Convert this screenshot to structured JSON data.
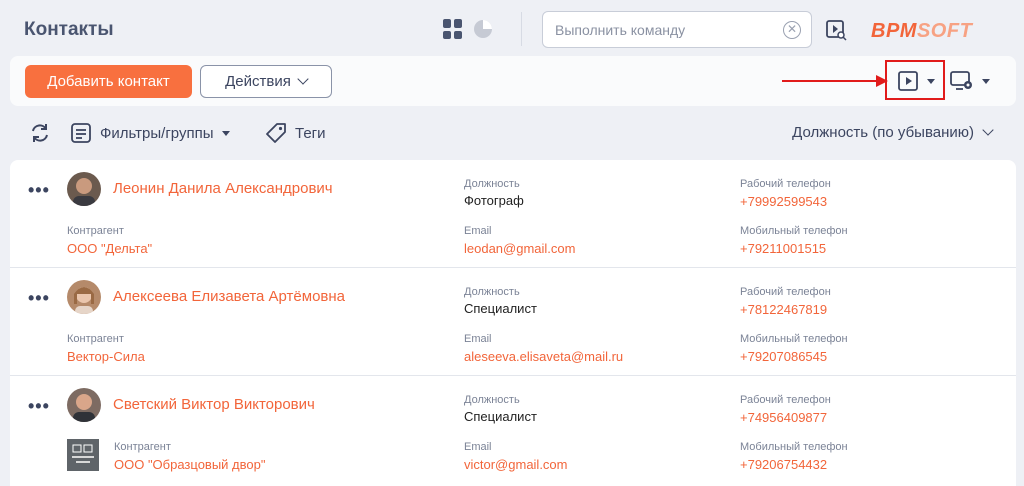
{
  "header": {
    "title": "Контакты",
    "command_placeholder": "Выполнить команду",
    "logo_a": "BPM",
    "logo_b": "SOFT"
  },
  "toolbar": {
    "add_label": "Добавить контакт",
    "actions_label": "Действия"
  },
  "filters": {
    "filters_label": "Фильтры/группы",
    "tags_label": "Теги",
    "sort_label": "Должность (по убыванию)"
  },
  "contacts": [
    {
      "name": "Леонин Данила Александрович",
      "position_label": "Должность",
      "position": "Фотограф",
      "work_phone_label": "Рабочий телефон",
      "work_phone": "+79992599543",
      "account_label": "Контрагент",
      "account": "ООО \"Дельта\"",
      "email_label": "Email",
      "email": "leodan@gmail.com",
      "mobile_label": "Мобильный телефон",
      "mobile": "+79211001515"
    },
    {
      "name": "Алексеева Елизавета Артёмовна",
      "position_label": "Должность",
      "position": "Специалист",
      "work_phone_label": "Рабочий телефон",
      "work_phone": "+78122467819",
      "account_label": "Контрагент",
      "account": "Вектор-Сила",
      "email_label": "Email",
      "email": "aleseeva.elisaveta@mail.ru",
      "mobile_label": "Мобильный телефон",
      "mobile": "+79207086545"
    },
    {
      "name": "Светский Виктор Викторович",
      "position_label": "Должность",
      "position": "Специалист",
      "work_phone_label": "Рабочий телефон",
      "work_phone": "+74956409877",
      "account_label": "Контрагент",
      "account": "ООО \"Образцовый двор\"",
      "email_label": "Email",
      "email": "victor@gmail.com",
      "mobile_label": "Мобильный телефон",
      "mobile": "+79206754432"
    }
  ],
  "colors": {
    "accent": "#f8703f",
    "link": "#f2653a",
    "highlight": "#e11b1b"
  }
}
